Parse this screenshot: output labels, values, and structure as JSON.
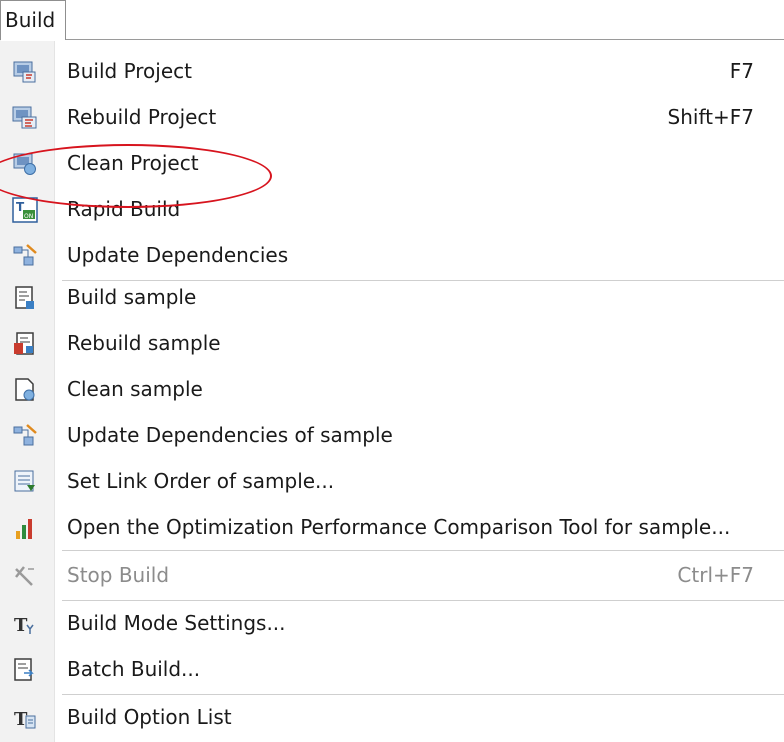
{
  "menu": {
    "title": "Build",
    "items": [
      {
        "label": "Build Project",
        "shortcut": "F7",
        "icon": "build-project-icon"
      },
      {
        "label": "Rebuild Project",
        "shortcut": "Shift+F7",
        "icon": "rebuild-project-icon"
      },
      {
        "label": "Clean Project",
        "shortcut": "",
        "icon": "clean-project-icon"
      },
      {
        "label": "Rapid Build",
        "shortcut": "",
        "icon": "rapid-build-icon"
      },
      {
        "label": "Update Dependencies",
        "shortcut": "",
        "icon": "update-dependencies-icon"
      },
      {
        "label": "Build sample",
        "shortcut": "",
        "icon": "build-sample-icon"
      },
      {
        "label": "Rebuild sample",
        "shortcut": "",
        "icon": "rebuild-sample-icon"
      },
      {
        "label": "Clean sample",
        "shortcut": "",
        "icon": "clean-sample-icon"
      },
      {
        "label": "Update Dependencies of sample",
        "shortcut": "",
        "icon": "update-dependencies-sample-icon"
      },
      {
        "label": "Set Link Order of sample...",
        "shortcut": "",
        "icon": "link-order-icon"
      },
      {
        "label": "Open the Optimization Performance Comparison Tool for sample...",
        "shortcut": "",
        "icon": "bar-chart-icon"
      },
      {
        "label": "Stop Build",
        "shortcut": "Ctrl+F7",
        "icon": "stop-build-icon",
        "disabled": true
      },
      {
        "label": "Build Mode Settings...",
        "shortcut": "",
        "icon": "build-mode-settings-icon"
      },
      {
        "label": "Batch Build...",
        "shortcut": "",
        "icon": "batch-build-icon"
      },
      {
        "label": "Build Option List",
        "shortcut": "",
        "icon": "build-option-list-icon"
      }
    ]
  },
  "colors": {
    "highlight": "#d7141e",
    "gutter": "#f2f2f2",
    "disabled_text": "#8c8c8c"
  }
}
